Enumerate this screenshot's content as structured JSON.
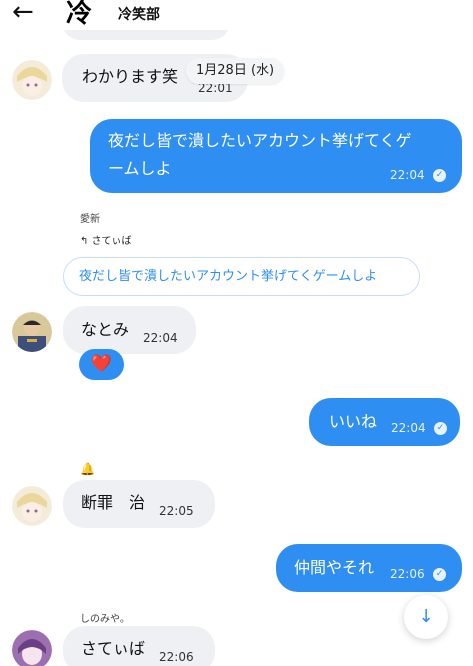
{
  "header": {
    "back_label": "←",
    "group_icon_char": "冷",
    "title": "冷笑部"
  },
  "date_badge": "1月28日 (水)",
  "messages": [
    {
      "type": "incoming",
      "text": "わかります笑",
      "time": "22:01"
    },
    {
      "type": "outgoing",
      "line1": "夜だし皆で潰したいアカウント挙げてくゲ",
      "line2": "ームしよ",
      "time": "22:04"
    },
    {
      "type": "incoming",
      "sender": "愛新",
      "reply_to": "さてぃば",
      "quote": "夜だし皆で潰したいアカウント挙げてくゲームしよ"
    },
    {
      "type": "incoming",
      "text": "なとみ",
      "time": "22:04",
      "reaction": "❤️"
    },
    {
      "type": "outgoing",
      "text": "いいね",
      "time": "22:04"
    },
    {
      "type": "incoming",
      "text": "断罪　治",
      "time": "22:05"
    },
    {
      "type": "outgoing",
      "text": "仲間やそれ",
      "time": "22:06"
    },
    {
      "type": "incoming",
      "sender": "しのみや。",
      "text": "さてぃば",
      "time": "22:06"
    }
  ],
  "icons": {
    "back": "arrow-left-icon",
    "bell": "bell-icon",
    "scroll": "arrow-down-icon",
    "check": "check-circle-icon"
  },
  "colors": {
    "accent": "#2f8ef2",
    "incoming_bubble": "#eef0f3"
  },
  "scroll_button_label": "↓",
  "bell_label": "🔔",
  "check_label": "✓"
}
